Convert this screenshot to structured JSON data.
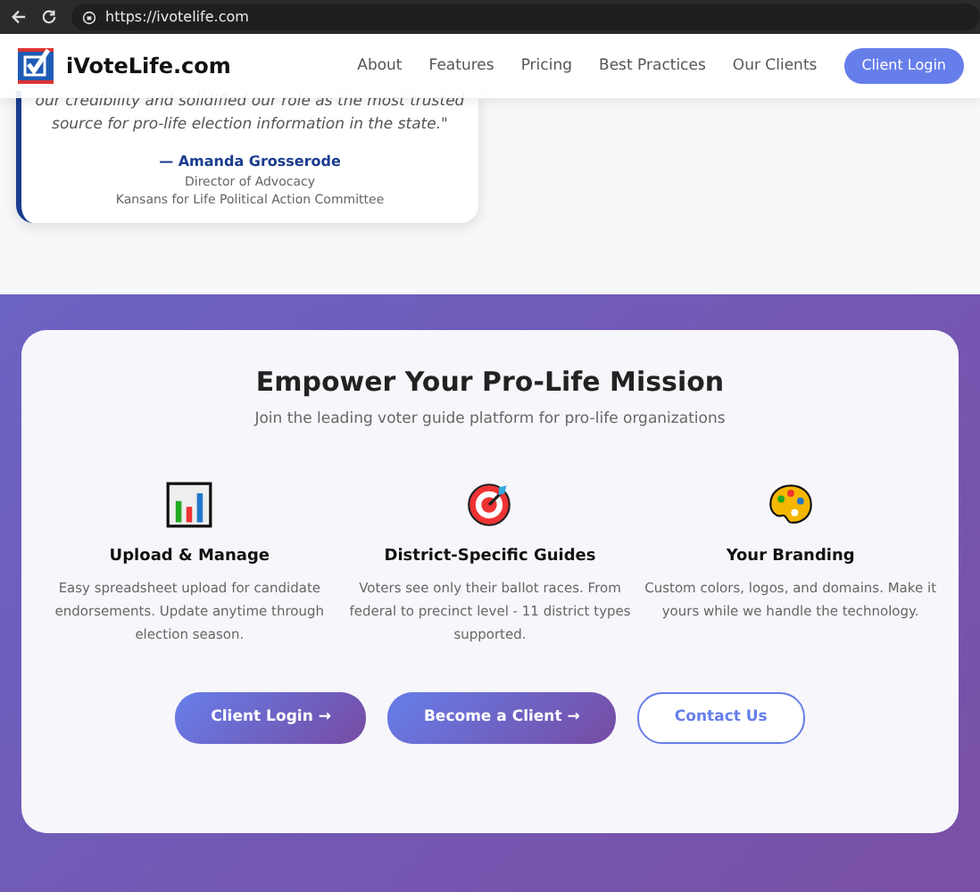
{
  "browser": {
    "url": "https://ivotelife.com"
  },
  "navbar": {
    "brand": "iVoteLife.com",
    "links": [
      "About",
      "Features",
      "Pricing",
      "Best Practices",
      "Our Clients"
    ],
    "login": "Client Login"
  },
  "testimonial": {
    "quote_lines": [
      "our credibility and solidified our role as the most trusted",
      "source for pro-life election information in the state.\""
    ],
    "author": "— Amanda Grosserode",
    "role": "Director of Advocacy",
    "organization": "Kansans for Life Political Action Committee"
  },
  "cta": {
    "title": "Empower Your Pro-Life Mission",
    "subtitle": "Join the leading voter guide platform for pro-life organizations",
    "features": [
      {
        "kind": "chart",
        "title": "Upload & Manage",
        "text": "Easy spreadsheet upload for candidate endorsements. Update anytime through election season."
      },
      {
        "kind": "target",
        "title": "District-Specific Guides",
        "text": "Voters see only their ballot races. From federal to precinct level - 11 district types supported."
      },
      {
        "kind": "palette",
        "title": "Your Branding",
        "text": "Custom colors, logos, and domains. Make it yours while we handle the technology."
      }
    ],
    "buttons": [
      {
        "label": "Client Login →",
        "kind": "filled"
      },
      {
        "label": "Become a Client →",
        "kind": "filled"
      },
      {
        "label": "Contact Us",
        "kind": "outline"
      }
    ]
  }
}
